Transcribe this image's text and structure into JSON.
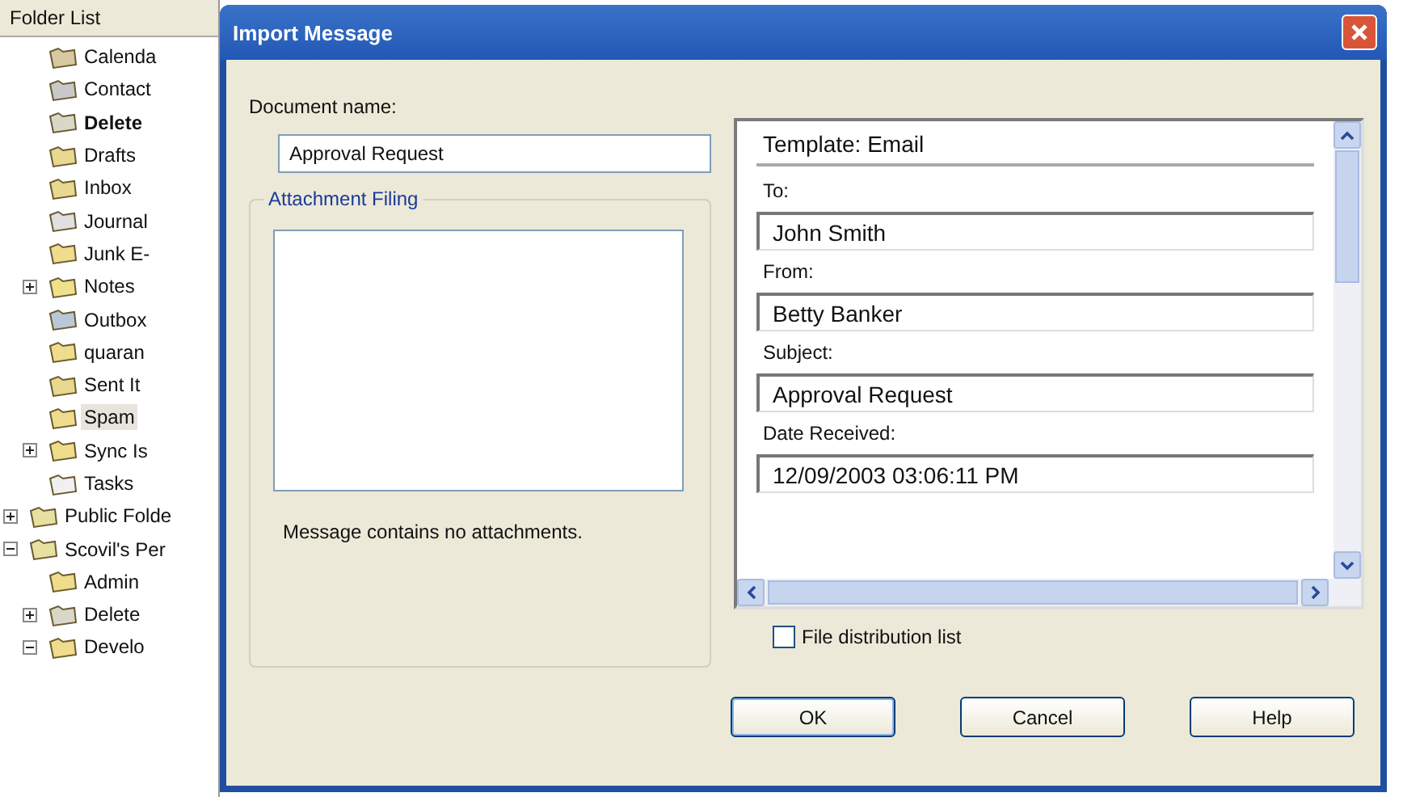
{
  "folder_list": {
    "title": "Folder List",
    "folders": [
      {
        "label": "Calenda",
        "kind": "calendar",
        "bold": false,
        "selected": false
      },
      {
        "label": "Contact",
        "kind": "contacts",
        "bold": false,
        "selected": false
      },
      {
        "label": "Delete",
        "kind": "trash",
        "bold": true,
        "selected": false
      },
      {
        "label": "Drafts",
        "kind": "drafts",
        "bold": false,
        "selected": false
      },
      {
        "label": "Inbox",
        "kind": "inbox",
        "bold": false,
        "selected": false
      },
      {
        "label": "Journal",
        "kind": "journal",
        "bold": false,
        "selected": false
      },
      {
        "label": "Junk E-",
        "kind": "folder",
        "bold": false,
        "selected": false
      },
      {
        "label": "Notes",
        "kind": "notes",
        "bold": false,
        "selected": false,
        "expanded": false
      },
      {
        "label": "Outbox",
        "kind": "outbox",
        "bold": false,
        "selected": false
      },
      {
        "label": "quaran",
        "kind": "folder",
        "bold": false,
        "selected": false
      },
      {
        "label": "Sent It",
        "kind": "sent",
        "bold": false,
        "selected": false
      },
      {
        "label": "Spam",
        "kind": "folder",
        "bold": false,
        "selected": true
      },
      {
        "label": "Sync Is",
        "kind": "folder",
        "bold": false,
        "selected": false,
        "expanded": false
      },
      {
        "label": "Tasks",
        "kind": "tasks",
        "bold": false,
        "selected": false
      }
    ],
    "roots": [
      {
        "label": "Public Folde",
        "kind": "store",
        "bold": false,
        "selected": false,
        "expanded": false
      },
      {
        "label": "Scovil's Per",
        "kind": "store",
        "bold": false,
        "selected": false,
        "expanded": true,
        "children": [
          {
            "label": "Admin",
            "kind": "folder",
            "bold": false,
            "selected": false
          },
          {
            "label": "Delete",
            "kind": "trash",
            "bold": false,
            "selected": false,
            "expanded": false
          },
          {
            "label": "Develo",
            "kind": "folder",
            "bold": false,
            "selected": false,
            "expanded": true
          }
        ]
      }
    ]
  },
  "dialog": {
    "title": "Import Message",
    "document_name": {
      "label": "Document name:",
      "value": "Approval Request"
    },
    "attachment_filing": {
      "title": "Attachment Filing",
      "message": "Message contains no attachments."
    },
    "template": {
      "title": "Template: Email",
      "fields": [
        {
          "label": "To:",
          "value": "John Smith"
        },
        {
          "label": "From:",
          "value": "Betty Banker"
        },
        {
          "label": "Subject:",
          "value": "Approval Request"
        },
        {
          "label": "Date Received:",
          "value": "12/09/2003 03:06:11 PM"
        }
      ]
    },
    "file_distribution_list": {
      "label": "File distribution list",
      "checked": false
    },
    "buttons": [
      "OK",
      "Cancel",
      "Help"
    ]
  }
}
